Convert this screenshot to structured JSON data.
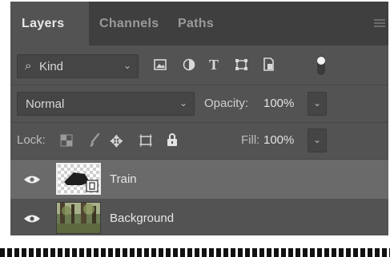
{
  "tabs": [
    {
      "label": "Layers",
      "active": true
    },
    {
      "label": "Channels",
      "active": false
    },
    {
      "label": "Paths",
      "active": false
    }
  ],
  "filter": {
    "kind_label": "Kind",
    "icons": [
      "image-filter-icon",
      "adjustment-filter-icon",
      "type-filter-icon",
      "shape-filter-icon",
      "smart-object-filter-icon",
      "filter-toggle-icon"
    ]
  },
  "blend": {
    "mode": "Normal",
    "opacity_label": "Opacity:",
    "opacity_value": "100%"
  },
  "lock": {
    "label": "Lock:",
    "icons": [
      "lock-transparent-pixels-icon",
      "lock-image-pixels-icon",
      "lock-position-icon",
      "lock-artboard-icon",
      "lock-all-icon"
    ],
    "fill_label": "Fill:",
    "fill_value": "100%"
  },
  "layers": [
    {
      "name": "Train",
      "visible": true,
      "selected": true,
      "type": "smart-object"
    },
    {
      "name": "Background",
      "visible": true,
      "selected": false,
      "type": "image"
    }
  ],
  "colors": {
    "panel": "#535353",
    "tabbar": "#3f3f3f",
    "selected_row": "#6a6a6a",
    "text": "#e6e6e6"
  }
}
